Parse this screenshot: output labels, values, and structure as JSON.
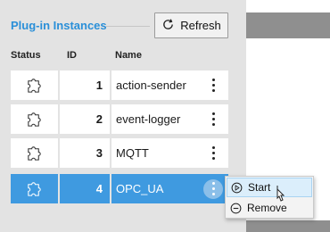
{
  "panel": {
    "title": "Plug-in Instances",
    "refresh_label": "Refresh",
    "refresh_icon": "refresh-icon"
  },
  "table": {
    "columns": [
      "Status",
      "ID",
      "Name"
    ],
    "rows": [
      {
        "status_icon": "puzzle-icon",
        "id": "1",
        "name": "action-sender",
        "selected": false
      },
      {
        "status_icon": "puzzle-icon",
        "id": "2",
        "name": "event-logger",
        "selected": false
      },
      {
        "status_icon": "puzzle-icon",
        "id": "3",
        "name": "MQTT",
        "selected": false
      },
      {
        "status_icon": "puzzle-icon",
        "id": "4",
        "name": "OPC_UA",
        "selected": true
      }
    ]
  },
  "context_menu": {
    "items": [
      {
        "label": "Start",
        "icon": "play-circle-icon",
        "highlighted": true
      },
      {
        "label": "Remove",
        "icon": "minus-circle-icon",
        "highlighted": false
      }
    ]
  },
  "colors": {
    "accent": "#2a8fd8",
    "selected_row": "#3f9ae0",
    "panel_bg": "#e3e3e3"
  }
}
